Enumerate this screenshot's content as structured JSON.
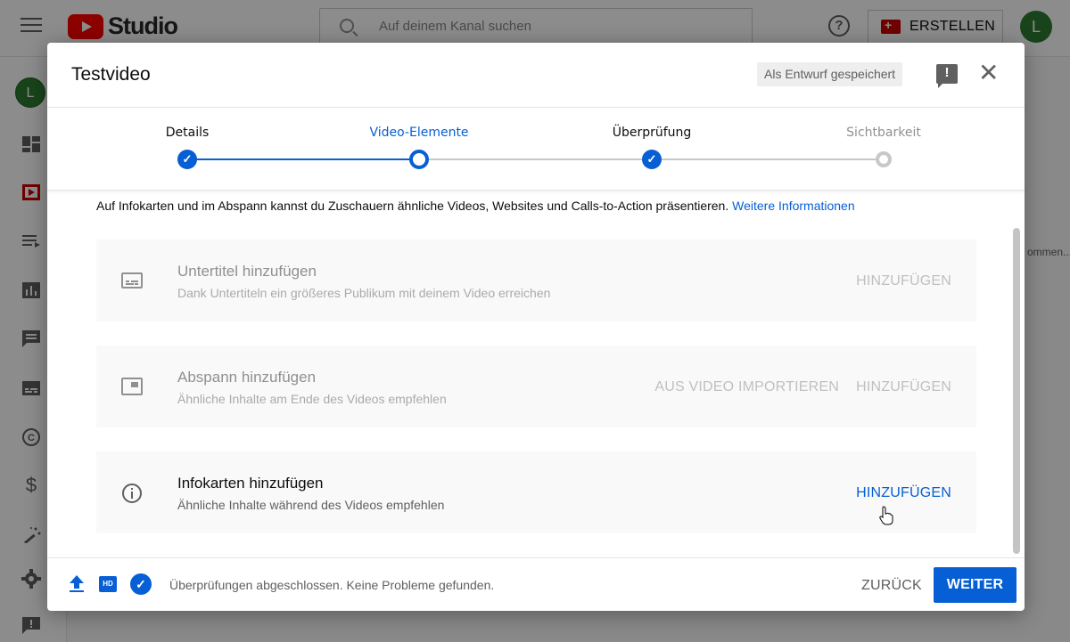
{
  "app": {
    "logo_text": "Studio",
    "search_placeholder": "Auf deinem Kanal suchen",
    "create_label": "ERSTELLEN",
    "avatar_letter": "L",
    "help_glyph": "?",
    "right_fragment": "ommen..."
  },
  "sidebar": {
    "avatar_letter": "L",
    "icons": [
      "dashboard-icon",
      "content-icon",
      "playlists-icon",
      "analytics-icon",
      "comments-icon",
      "subtitles-icon",
      "copyright-icon",
      "monetization-icon",
      "customization-icon",
      "settings-icon",
      "feedback-icon"
    ]
  },
  "dialog": {
    "title": "Testvideo",
    "draft_badge": "Als Entwurf gespeichert",
    "close_glyph": "✕",
    "steps": [
      {
        "label": "Details",
        "state": "done"
      },
      {
        "label": "Video-Elemente",
        "state": "current"
      },
      {
        "label": "Überprüfung",
        "state": "done"
      },
      {
        "label": "Sichtbarkeit",
        "state": "todo"
      }
    ],
    "intro_text": "Auf Infokarten und im Abspann kannst du Zuschauern ähnliche Videos, Websites und Calls-to-Action präsentieren.",
    "intro_link": "Weitere Informationen",
    "cards": [
      {
        "title": "Untertitel hinzufügen",
        "subtitle": "Dank Untertiteln ein größeres Publikum mit deinem Video erreichen",
        "button": "HINZUFÜGEN",
        "enabled": false
      },
      {
        "title": "Abspann hinzufügen",
        "subtitle": "Ähnliche Inhalte am Ende des Videos empfehlen",
        "secondary_button": "AUS VIDEO IMPORTIEREN",
        "button": "HINZUFÜGEN",
        "enabled": false
      },
      {
        "title": "Infokarten hinzufügen",
        "subtitle": "Ähnliche Inhalte während des Videos empfehlen",
        "button": "HINZUFÜGEN",
        "enabled": true
      }
    ],
    "footer": {
      "hd_badge": "HD",
      "status": "Überprüfungen abgeschlossen. Keine Probleme gefunden.",
      "back_label": "ZURÜCK",
      "next_label": "WEITER"
    }
  },
  "colors": {
    "accent": "#065fd4",
    "brand_red": "#ff0000",
    "avatar_green": "#2e7d32"
  }
}
